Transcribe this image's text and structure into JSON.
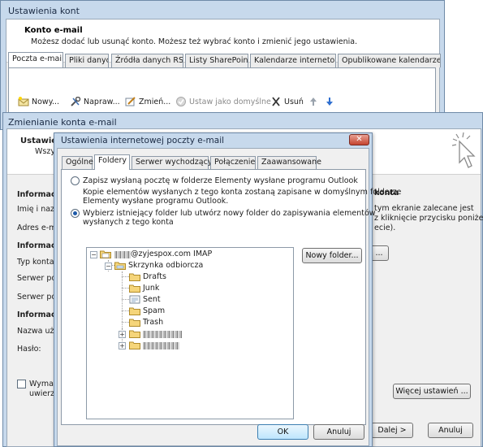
{
  "accounts_window": {
    "title": "Ustawienia kont",
    "header_title": "Konto e-mail",
    "header_desc": "Możesz dodać lub usunąć konto. Możesz też wybrać konto i zmienić jego ustawienia.",
    "tabs": [
      "Poczta e-mail",
      "Pliki danych",
      "Źródła danych RSS",
      "Listy SharePoint",
      "Kalendarze internetowe",
      "Opublikowane kalendarze"
    ],
    "active_tab": "Poczta e-mail",
    "toolbar": {
      "new": "Nowy...",
      "repair": "Napraw...",
      "change": "Zmień...",
      "set_default": "Ustaw jako domyślne",
      "remove": "Usuń"
    }
  },
  "change_window": {
    "title": "Zmienianie konta e-mail",
    "header_title": "Ustawien",
    "header_sub": "Wszy",
    "section_user": "Informac",
    "field_name": "Imię i nazwi",
    "field_email": "Adres e-mai",
    "section_server": "Informac",
    "field_type": "Typ konta:",
    "field_in_server": "Serwer pocz",
    "field_out_server": "Serwer pocz",
    "section_login": "Informac",
    "field_user": "Nazwa użyt",
    "field_password": "Hasło:",
    "checkbox_label": "Wymaga",
    "checkbox_label_2": "uwierzyt",
    "right_title": "konta",
    "right_desc_1": "tym ekranie zalecane jest",
    "right_desc_2": "z kliknięcie przycisku poniżej",
    "right_desc_3": "ecie).",
    "more_settings_button": "Więcej ustawień ...",
    "next_button": "Dalej >",
    "cancel_button": "Anuluj"
  },
  "internet_settings_window": {
    "title": "Ustawienia internetowej poczty e-mail",
    "tabs": [
      "Ogólne",
      "Foldery",
      "Serwer wychodzący",
      "Połączenie",
      "Zaawansowane"
    ],
    "active_tab": "Foldery",
    "radio_1_label": "Zapisz wysłaną pocztę w folderze Elementy wysłane programu Outlook",
    "radio_1_desc_line1": "Kopie elementów wysłanych z tego konta zostaną zapisane w domyślnym folderze",
    "radio_1_desc_line2": "Elementy wysłane programu Outlook.",
    "radio_2_label_line1": "Wybierz istniejący folder lub utwórz nowy folder do zapisywania elementów",
    "radio_2_label_line2": "wysłanych z tego konta",
    "selected_radio": 2,
    "tree": {
      "account": "@zyjespox.com IMAP",
      "inbox": "Skrzynka odbiorcza",
      "subfolders": [
        "Drafts",
        "Junk",
        "Sent",
        "Spam",
        "Trash"
      ]
    },
    "new_folder_button": "Nowy folder...",
    "ok_button": "OK",
    "cancel_button": "Anuluj"
  },
  "colors": {
    "window_frame": "#c7d9ec",
    "close_button": "#c4442f",
    "client_bg": "#f0f0f0"
  }
}
